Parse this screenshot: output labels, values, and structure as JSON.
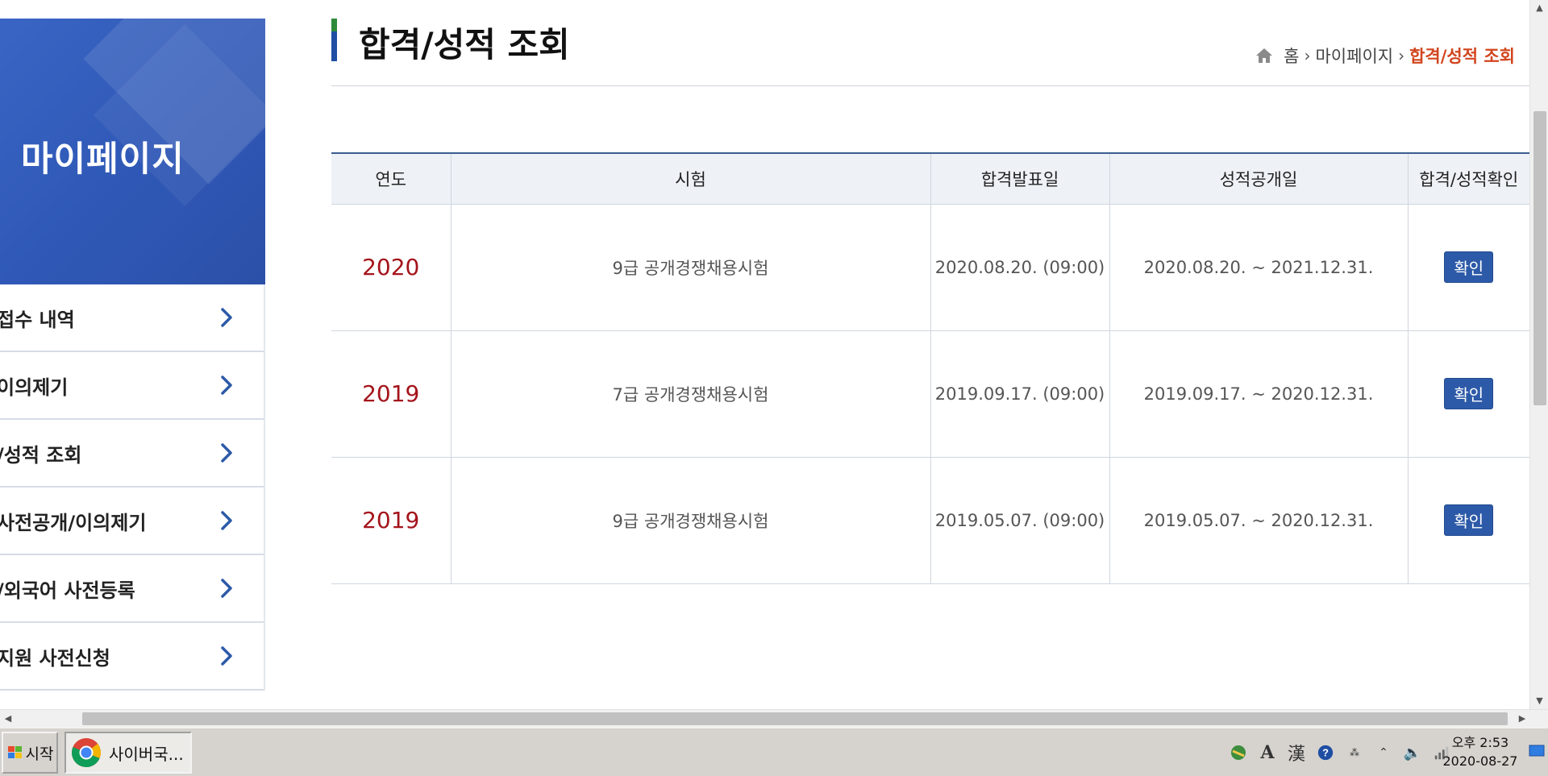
{
  "sidebar": {
    "title": "마이페이지",
    "items": [
      {
        "label": "접수 내역"
      },
      {
        "label": "이의제기"
      },
      {
        "label": "/성적 조회"
      },
      {
        "label": "사전공개/이의제기"
      },
      {
        "label": "/외국어 사전등록"
      },
      {
        "label": "지원 사전신청"
      }
    ]
  },
  "header": {
    "title": "합격/성적 조회",
    "breadcrumb": [
      "홈",
      "마이페이지",
      "합격/성적 조회"
    ]
  },
  "table": {
    "columns": [
      "연도",
      "시험",
      "합격발표일",
      "성적공개일",
      "합격/성적확인"
    ],
    "rows": [
      {
        "year": "2020",
        "exam": "9급 공개경쟁채용시험",
        "announce": "2020.08.20. (09:00)",
        "period": "2020.08.20. ~ 2021.12.31.",
        "action": "확인"
      },
      {
        "year": "2019",
        "exam": "7급 공개경쟁채용시험",
        "announce": "2019.09.17. (09:00)",
        "period": "2019.09.17. ~ 2020.12.31.",
        "action": "확인"
      },
      {
        "year": "2019",
        "exam": "9급 공개경쟁채용시험",
        "announce": "2019.05.07. (09:00)",
        "period": "2019.05.07. ~ 2020.12.31.",
        "action": "확인"
      }
    ]
  },
  "taskbar": {
    "start_label": "시작",
    "task_label": "사이버국...",
    "clock_time": "오후 2:53",
    "clock_date": "2020-08-27",
    "tray_icons": [
      "network-icon",
      "ime-alpha-icon",
      "hanja-icon",
      "help-icon",
      "ime-settings-icon",
      "tray-expand-icon",
      "speaker-icon",
      "signal-icon"
    ]
  },
  "colors": {
    "sidebar_bg": "#2f58b6",
    "year_red": "#a4141b",
    "breadcrumb_current": "#d2451e",
    "button_blue": "#2d5aa8"
  }
}
